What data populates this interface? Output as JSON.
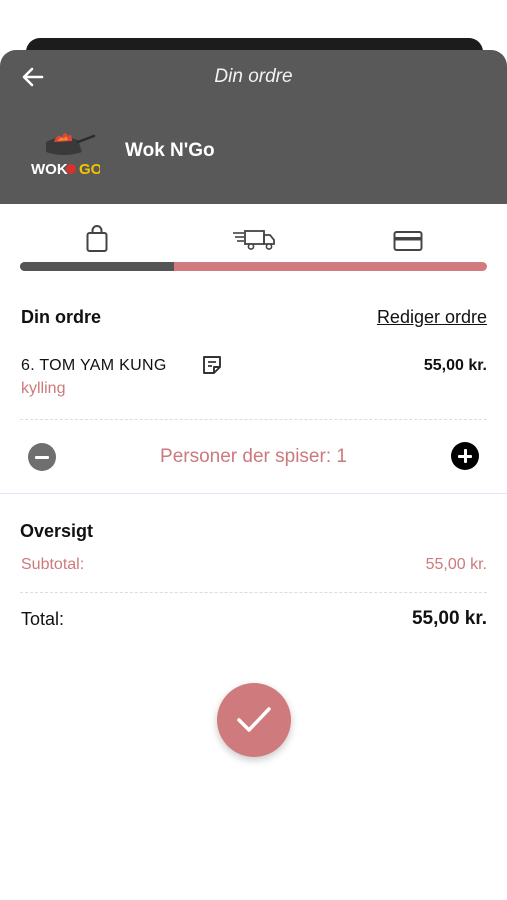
{
  "header": {
    "title": "Din ordre",
    "restaurant_name": "Wok N'Go",
    "logo_text": "WOK N GO",
    "background_color": "#595959"
  },
  "steps": {
    "icons": [
      "shopping-bag-icon",
      "delivery-truck-icon",
      "credit-card-icon"
    ],
    "progress_fraction": 0.33,
    "progress_done_color": "#555555",
    "progress_remaining_color": "#d27b7e"
  },
  "order": {
    "section_title": "Din ordre",
    "edit_label": "Rediger ordre",
    "items": [
      {
        "name": "6. TOM YAM KUNG",
        "variant": "kylling",
        "price": "55,00 kr."
      }
    ],
    "persons_label": "Personer der spiser: 1"
  },
  "overview": {
    "title": "Oversigt",
    "subtotal_label": "Subtotal:",
    "subtotal_value": "55,00 kr.",
    "total_label": "Total:",
    "total_value": "55,00 kr."
  },
  "colors": {
    "accent": "#cc7a7d",
    "confirm_button": "#cf7b7e"
  }
}
